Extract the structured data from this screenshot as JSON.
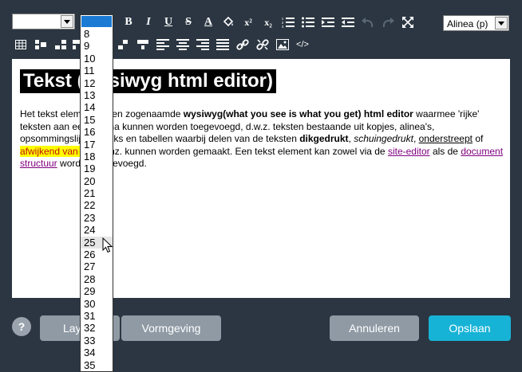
{
  "toolbar": {
    "font_select_value": "",
    "format_select_value": "Alinea (p)",
    "bold_glyph": "B",
    "italic_glyph": "I",
    "underline_glyph": "U",
    "strike_glyph": "S",
    "fontcolor_glyph": "A",
    "superscript_glyph": "x²",
    "subscript_glyph": "x₂",
    "code_glyph": "</>"
  },
  "editor": {
    "heading": "Tekst (wysiwyg html editor)",
    "p_intro": "Het tekst element is een zogenaamde ",
    "p_bold1": "wysiwyg(what you see is what you get) html editor",
    "p_mid1": " waarmee 'rijke' teksten aan een pagina kunnen worden toegevoegd, d.w.z. teksten bestaande uit kopjes, alinea's, opsommingslijsten, links en tabellen waarbij delen van de teksten ",
    "p_bold2": "dikgedrukt",
    "p_comma": ", ",
    "p_italic": "schuingedrukt",
    "p_comma2": ", ",
    "p_underline": "onderstreept",
    "p_space": " of ",
    "p_highlight": "afwijkend van kleur",
    "p_mid2": " enz. kunnen worden gemaakt. Een tekst element kan zowel via de ",
    "p_link1": "site-editor",
    "p_mid3": " als de ",
    "p_link2": "document structuur",
    "p_end": " worden toegevoegd."
  },
  "dropdown": {
    "items": [
      "8",
      "9",
      "10",
      "11",
      "12",
      "13",
      "14",
      "15",
      "16",
      "17",
      "18",
      "19",
      "20",
      "21",
      "22",
      "23",
      "24",
      "25",
      "26",
      "27",
      "28",
      "29",
      "30",
      "31",
      "32",
      "33",
      "34",
      "35"
    ],
    "hovered": "25"
  },
  "footer": {
    "help": "?",
    "layout_label": "Layout",
    "vormgeving_label": "Vormgeving",
    "annuleren_label": "Annuleren",
    "opslaan_label": "Opslaan"
  },
  "colors": {
    "background": "#2b3642",
    "accent": "#17b3d6",
    "button_gray": "#8f9aa4",
    "dropdown_selected": "#1a7ad4",
    "highlight": "#ffff00"
  }
}
